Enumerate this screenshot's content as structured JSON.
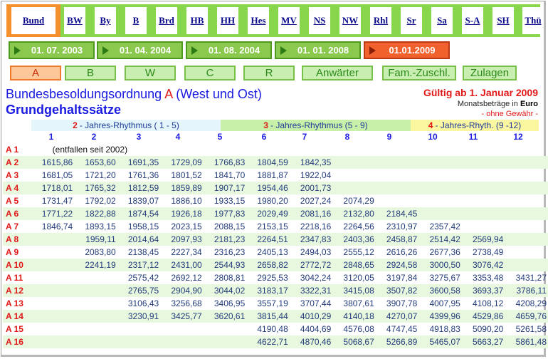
{
  "tabs": [
    "Bund",
    "BW",
    "By",
    "B",
    "Brd",
    "HB",
    "HH",
    "Hes",
    "MV",
    "NS",
    "NW",
    "Rhl",
    "Sr",
    "Sa",
    "S-A",
    "SH",
    "Thü"
  ],
  "active_tab": 0,
  "dates": [
    "01. 07. 2003",
    "01. 04. 2004",
    "01. 08. 2004",
    "01. 01. 2008",
    "01.01.2009"
  ],
  "active_date": 4,
  "categories": [
    "A",
    "B",
    "W",
    "C",
    "R",
    "Anwärter",
    "Fam.-Zuschl.",
    "Zulagen"
  ],
  "active_category": 0,
  "title": {
    "pre": "Bundesbesoldungsordnung ",
    "letter": "A",
    "post": " (West und Ost)"
  },
  "subtitle": "Grundgehaltssätze",
  "valid": "Gültig ab 1. Januar  2009",
  "units_pre": "Monatsbeträge in ",
  "units_bold": "Euro",
  "no_guarantee": "- ohne Gewähr -",
  "rhythm": [
    {
      "num": "2",
      "text": "- Jahres-Rhythmus ( 1 - 5)"
    },
    {
      "num": "3",
      "text": "- Jahres-Rhythmus (5 - 9)"
    },
    {
      "num": "4",
      "text": "- Jahres-Rhyth. (9 -12)"
    }
  ],
  "steps": [
    "1",
    "2",
    "3",
    "4",
    "5",
    "6",
    "7",
    "8",
    "9",
    "10",
    "11",
    "12"
  ],
  "rows": [
    {
      "grade": "A 1",
      "note": "(entfallen seit 2002)",
      "values": []
    },
    {
      "grade": "A 2",
      "values": [
        "1615,86",
        "1653,60",
        "1691,35",
        "1729,09",
        "1766,83",
        "1804,59",
        "1842,35",
        "",
        "",
        "",
        "",
        ""
      ]
    },
    {
      "grade": "A 3",
      "values": [
        "1681,05",
        "1721,20",
        "1761,36",
        "1801,52",
        "1841,70",
        "1881,87",
        "1922,04",
        "",
        "",
        "",
        "",
        ""
      ]
    },
    {
      "grade": "A 4",
      "values": [
        "1718,01",
        "1765,32",
        "1812,59",
        "1859,89",
        "1907,17",
        "1954,46",
        "2001,73",
        "",
        "",
        "",
        "",
        ""
      ]
    },
    {
      "grade": "A 5",
      "values": [
        "1731,47",
        "1792,02",
        "1839,07",
        "1886,10",
        "1933,15",
        "1980,20",
        "2027,24",
        "2074,29",
        "",
        "",
        "",
        ""
      ]
    },
    {
      "grade": "A 6",
      "values": [
        "1771,22",
        "1822,88",
        "1874,54",
        "1926,18",
        "1977,83",
        "2029,49",
        "2081,16",
        "2132,80",
        "2184,45",
        "",
        "",
        ""
      ]
    },
    {
      "grade": "A 7",
      "values": [
        "1846,74",
        "1893,15",
        "1958,15",
        "2023,15",
        "2088,15",
        "2153,15",
        "2218,16",
        "2264,56",
        "2310,97",
        "2357,42",
        "",
        ""
      ]
    },
    {
      "grade": "A 8",
      "values": [
        "",
        "1959,11",
        "2014,64",
        "2097,93",
        "2181,23",
        "2264,51",
        "2347,83",
        "2403,36",
        "2458,87",
        "2514,42",
        "2569,94",
        ""
      ]
    },
    {
      "grade": "A 9",
      "values": [
        "",
        "2083,80",
        "2138,45",
        "2227,34",
        "2316,23",
        "2405,13",
        "2494,03",
        "2555,12",
        "2616,26",
        "2677,36",
        "2738,49",
        ""
      ]
    },
    {
      "grade": "A 10",
      "values": [
        "",
        "2241,19",
        "2317,12",
        "2431,00",
        "2544,93",
        "2658,82",
        "2772,72",
        "2848,65",
        "2924,58",
        "3000,50",
        "3076,42",
        ""
      ]
    },
    {
      "grade": "A 11",
      "values": [
        "",
        "",
        "2575,42",
        "2692,12",
        "2808,81",
        "2925,53",
        "3042,24",
        "3120,05",
        "3197,84",
        "3275,67",
        "3353,48",
        "3431,27"
      ]
    },
    {
      "grade": "A 12",
      "values": [
        "",
        "",
        "2765,75",
        "2904,90",
        "3044,02",
        "3183,17",
        "3322,31",
        "3415,08",
        "3507,82",
        "3600,58",
        "3693,37",
        "3786,11"
      ]
    },
    {
      "grade": "A 13",
      "values": [
        "",
        "",
        "3106,43",
        "3256,68",
        "3406,95",
        "3557,19",
        "3707,44",
        "3807,61",
        "3907,78",
        "4007,95",
        "4108,12",
        "4208,29"
      ]
    },
    {
      "grade": "A 14",
      "values": [
        "",
        "",
        "3230,91",
        "3425,77",
        "3620,61",
        "3815,44",
        "4010,29",
        "4140,18",
        "4270,07",
        "4399,96",
        "4529,86",
        "4659,76"
      ]
    },
    {
      "grade": "A 15",
      "values": [
        "",
        "",
        "",
        "",
        "",
        "4190,48",
        "4404,69",
        "4576,08",
        "4747,45",
        "4918,83",
        "5090,20",
        "5261,58"
      ]
    },
    {
      "grade": "A 16",
      "values": [
        "",
        "",
        "",
        "",
        "",
        "4622,71",
        "4870,46",
        "5068,67",
        "5266,89",
        "5465,07",
        "5663,27",
        "5861,48"
      ]
    }
  ]
}
